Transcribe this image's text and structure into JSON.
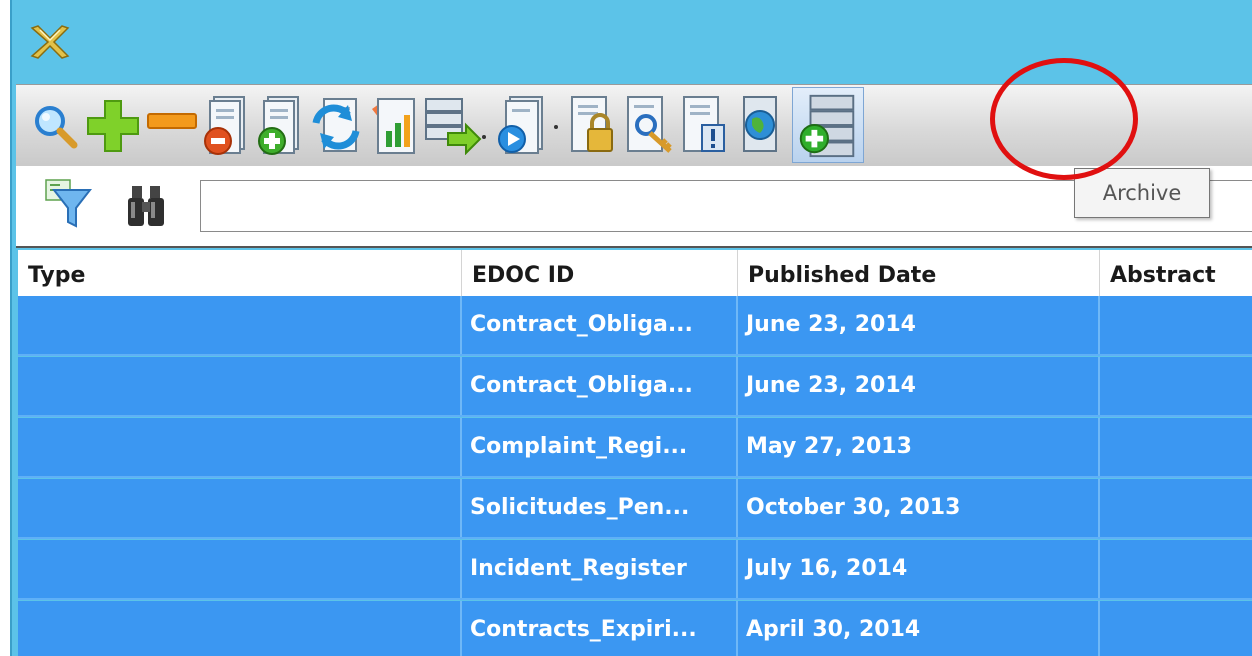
{
  "window": {
    "logo_icon": "app-logo-icon"
  },
  "toolbar": {
    "buttons": [
      {
        "name": "search",
        "icon": "magnifier-icon"
      },
      {
        "name": "add",
        "icon": "plus-icon"
      },
      {
        "name": "remove",
        "icon": "minus-icon"
      },
      {
        "name": "delete-document",
        "icon": "document-delete-icon"
      },
      {
        "name": "add-document",
        "icon": "document-add-icon"
      },
      {
        "name": "refresh-document",
        "icon": "document-refresh-icon"
      },
      {
        "name": "report",
        "icon": "chart-report-icon"
      },
      {
        "name": "export",
        "icon": "export-list-icon"
      },
      {
        "name": "document-actions",
        "icon": "document-play-icon"
      },
      {
        "name": "lock-document",
        "icon": "document-lock-icon"
      },
      {
        "name": "document-key",
        "icon": "document-key-icon"
      },
      {
        "name": "document-info",
        "icon": "document-info-icon"
      },
      {
        "name": "document-globe",
        "icon": "globe-document-icon"
      },
      {
        "name": "archive",
        "icon": "archive-add-icon"
      }
    ],
    "tooltip": "Archive"
  },
  "filterbar": {
    "filter_icon": "filter-icon",
    "find_icon": "binoculars-icon",
    "search_value": ""
  },
  "grid": {
    "columns": [
      "Type",
      "EDOC ID",
      "Published Date",
      "Abstract"
    ],
    "rows": [
      {
        "type": "",
        "edoc_id": "Contract_Obliga...",
        "published": "June 23, 2014",
        "abstract": ""
      },
      {
        "type": "",
        "edoc_id": "Contract_Obliga...",
        "published": "June 23, 2014",
        "abstract": ""
      },
      {
        "type": "",
        "edoc_id": "Complaint_Regi...",
        "published": "May 27, 2013",
        "abstract": ""
      },
      {
        "type": "",
        "edoc_id": "Solicitudes_Pen...",
        "published": "October 30, 2013",
        "abstract": ""
      },
      {
        "type": "",
        "edoc_id": "Incident_Register",
        "published": "July 16, 2014",
        "abstract": ""
      },
      {
        "type": "",
        "edoc_id": "Contracts_Expiri...",
        "published": "April 30, 2014",
        "abstract": ""
      }
    ]
  },
  "colors": {
    "window_bg": "#5cc3e8",
    "selection": "#3b97f2",
    "highlight_ring": "#e01010"
  }
}
